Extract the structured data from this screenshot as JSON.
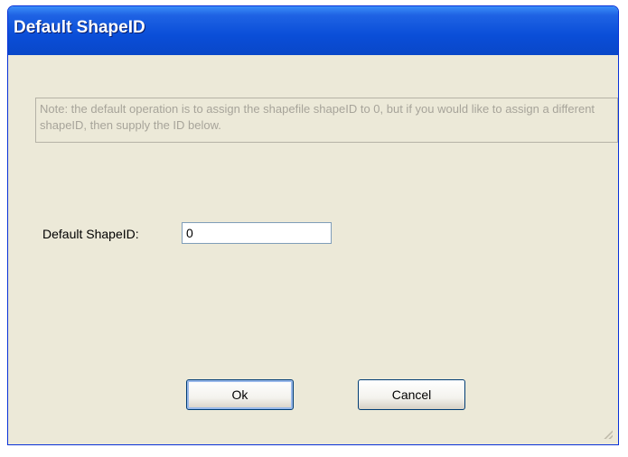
{
  "window": {
    "title": "Default ShapeID"
  },
  "note": {
    "text": "Note: the default operation is to assign the shapefile shapeID to 0, but if you would like to assign a different shapeID, then supply the ID below."
  },
  "form": {
    "label": "Default ShapeID:",
    "value": "0"
  },
  "buttons": {
    "ok_label": "Ok",
    "cancel_label": "Cancel"
  }
}
